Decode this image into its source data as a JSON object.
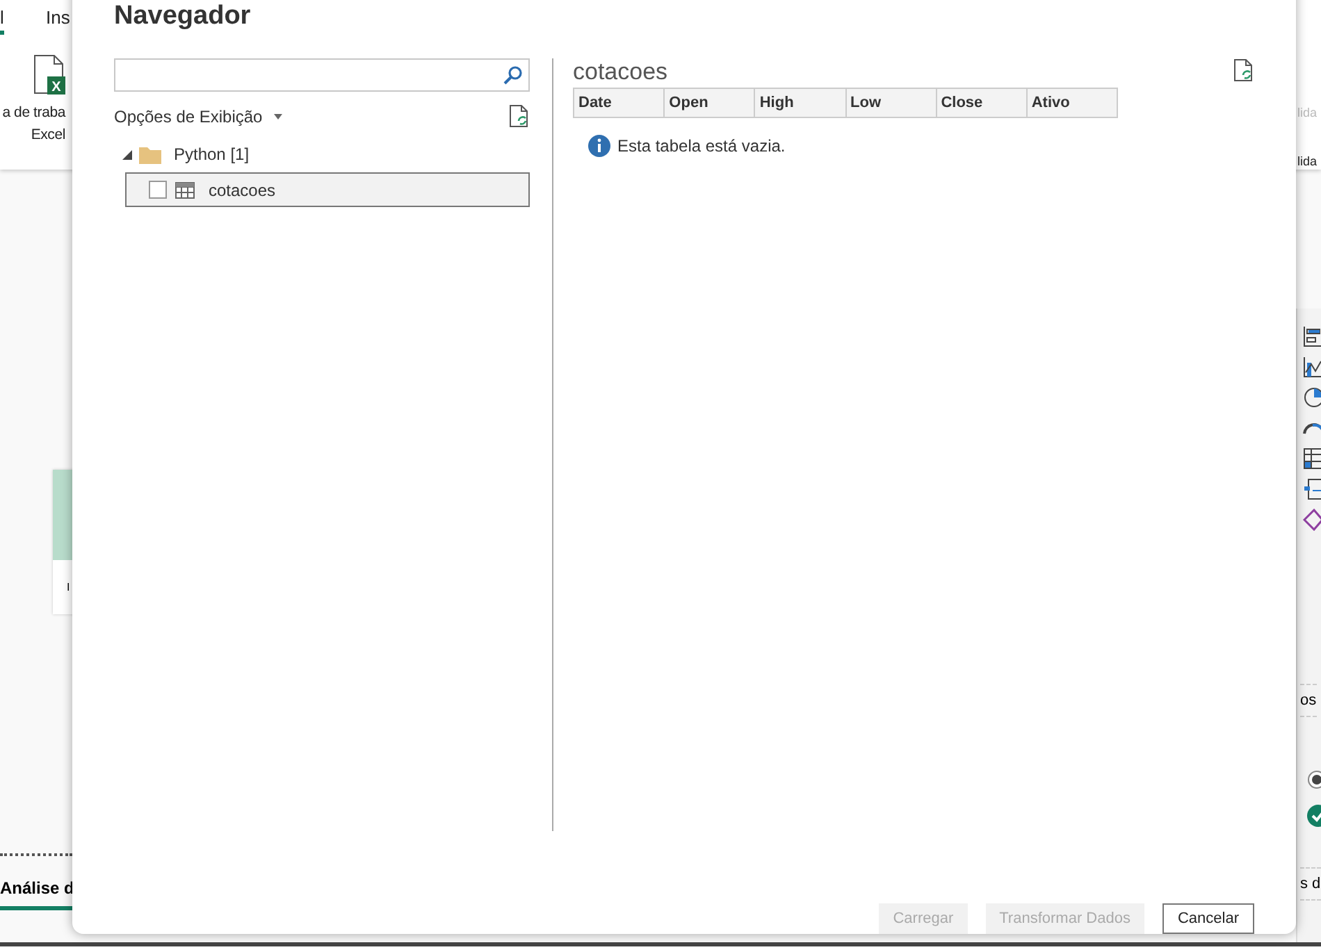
{
  "background_app": {
    "tabs": [
      {
        "label": "l",
        "selected": true
      },
      {
        "label": "Ins",
        "selected": false
      }
    ],
    "ribbon_button": {
      "icon_text": "X",
      "lines": [
        "a de traba",
        "Excel"
      ]
    },
    "card": {
      "label": "I"
    },
    "right_texts": [
      "lida",
      "lida"
    ],
    "right_pane": {
      "labels": [
        "os",
        "s d"
      ]
    },
    "bottom_tab": {
      "label": "Análise d",
      "selected": true
    }
  },
  "dialog": {
    "title": "Navegador",
    "display_options": "Opções de Exibição",
    "tree": [
      {
        "label": "Python [1]",
        "expanded": true,
        "children": [
          {
            "label": "cotacoes",
            "checked": false,
            "selected": true
          }
        ]
      }
    ],
    "preview": {
      "title": "cotacoes",
      "columns": [
        "Date",
        "Open",
        "High",
        "Low",
        "Close",
        "Ativo"
      ],
      "message": "Esta tabela está vazia."
    },
    "buttons": [
      {
        "label": "Carregar",
        "disabled": true
      },
      {
        "label": "Transformar Dados",
        "disabled": true
      },
      {
        "label": "Cancelar",
        "disabled": false
      }
    ]
  }
}
